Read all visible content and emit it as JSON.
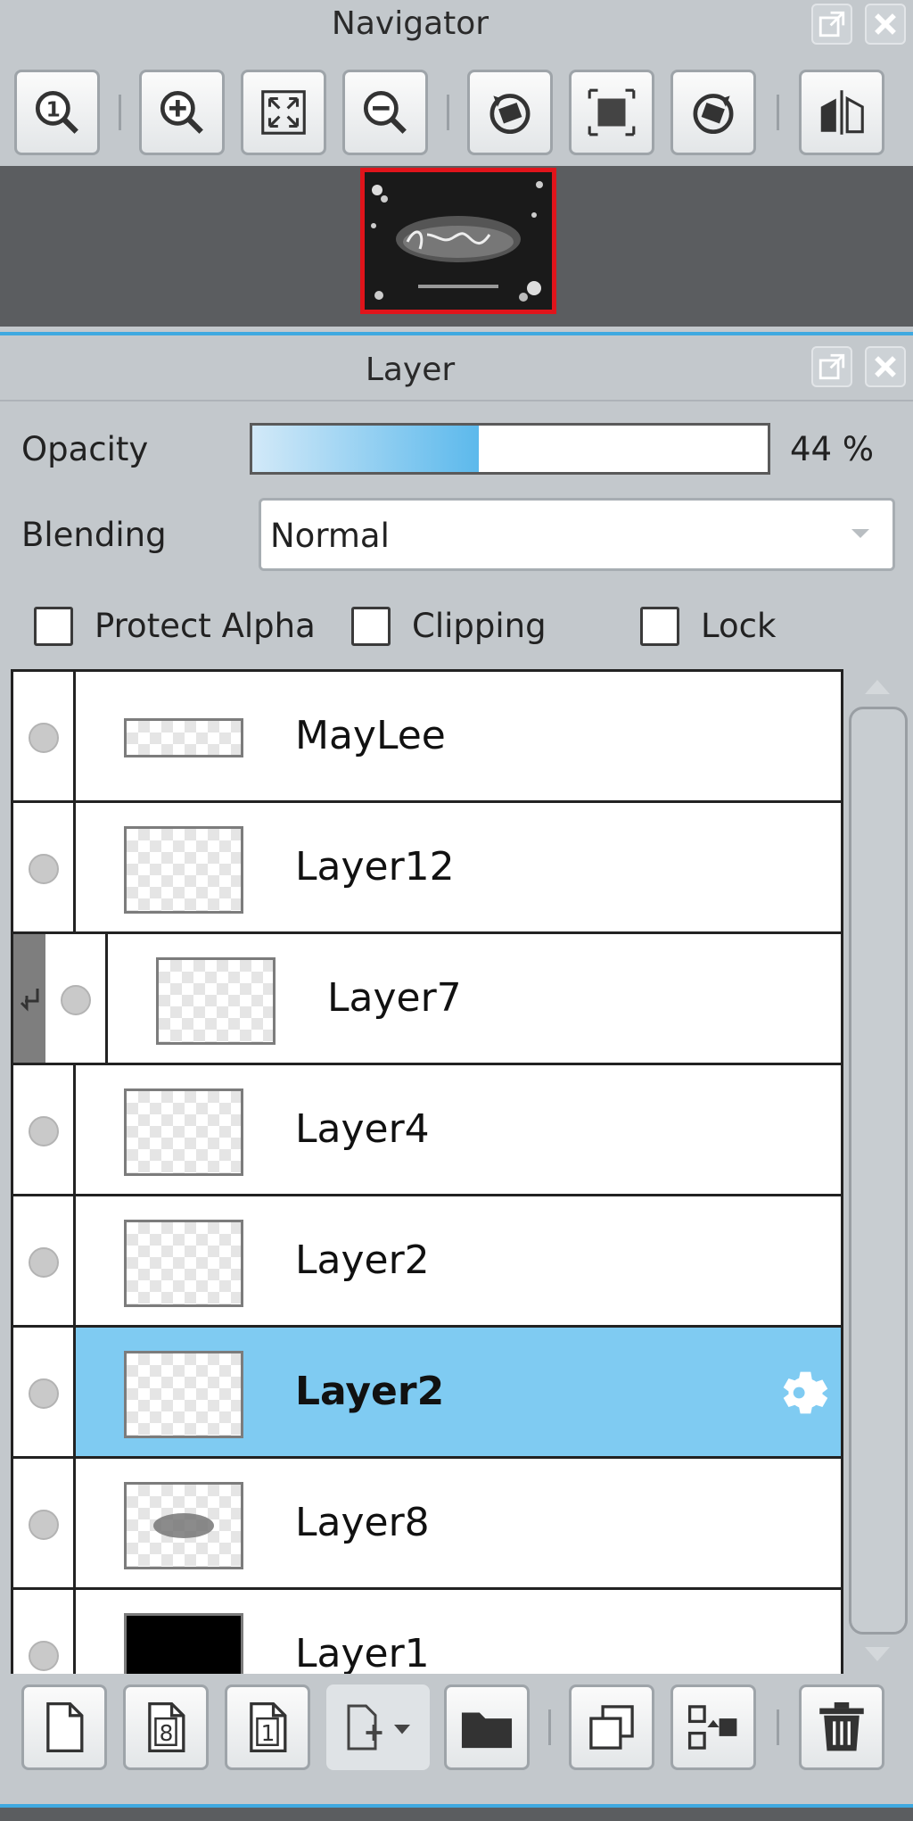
{
  "navigator": {
    "title": "Navigator",
    "toolbar": [
      "zoom-actual-icon",
      "zoom-in-icon",
      "fit-window-icon",
      "zoom-out-icon",
      "rotate-left-icon",
      "fit-canvas-icon",
      "rotate-right-icon",
      "flip-horizontal-icon"
    ]
  },
  "layer_panel": {
    "title": "Layer",
    "opacity_label": "Opacity",
    "opacity_value": "44 %",
    "opacity_level": 0.44,
    "blending_label": "Blending",
    "blending_value": "Normal",
    "protect_alpha_label": "Protect Alpha",
    "clipping_label": "Clipping",
    "lock_label": "Lock"
  },
  "layers": [
    {
      "name": "MayLee",
      "selected": false,
      "clipped": false
    },
    {
      "name": "Layer12",
      "selected": false,
      "clipped": false
    },
    {
      "name": "Layer7",
      "selected": false,
      "clipped": true
    },
    {
      "name": "Layer4",
      "selected": false,
      "clipped": false
    },
    {
      "name": "Layer2",
      "selected": false,
      "clipped": false
    },
    {
      "name": "Layer2",
      "selected": true,
      "clipped": false
    },
    {
      "name": "Layer8",
      "selected": false,
      "clipped": false
    },
    {
      "name": "Layer1",
      "selected": false,
      "clipped": false
    }
  ],
  "bottom_toolbar": [
    "new-layer-icon",
    "new-8bit-layer-icon",
    "new-1bit-layer-icon",
    "add-layer-menu-icon",
    "folder-icon",
    "duplicate-layer-icon",
    "merge-down-icon",
    "delete-layer-icon"
  ],
  "colors": {
    "accent": "#3fa9e0",
    "selected_row": "#7fcbf2",
    "panel_bg": "#c3c8cc"
  }
}
